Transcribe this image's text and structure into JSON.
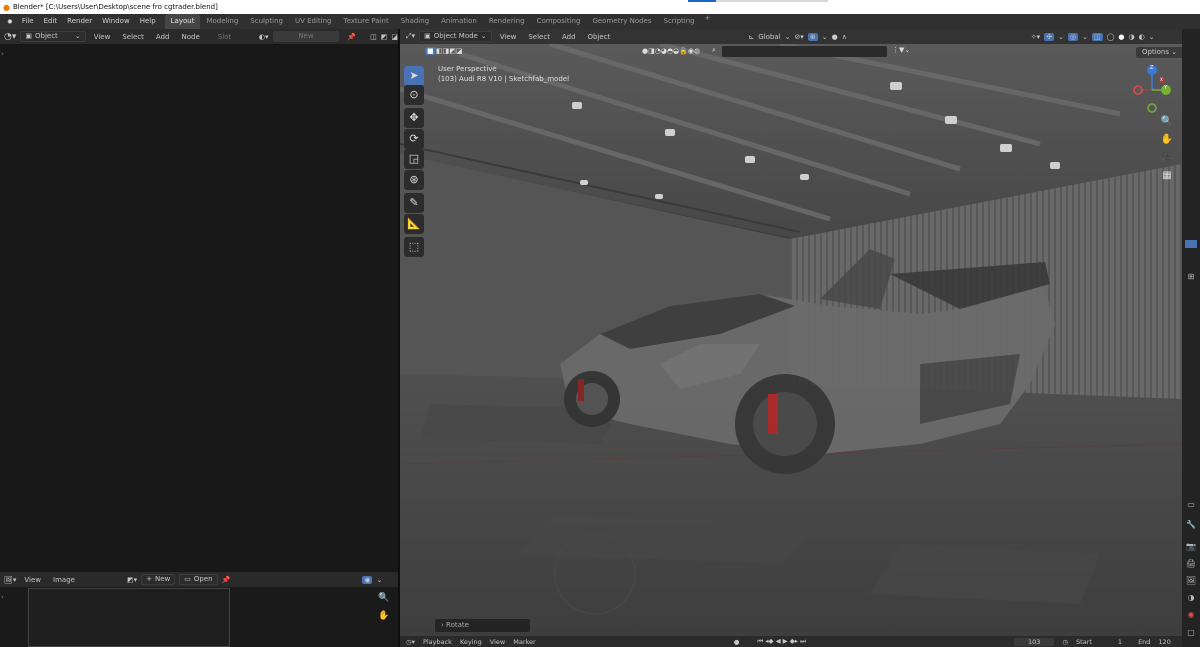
{
  "window": {
    "title": "Blender* [C:\\Users\\User\\Desktop\\scene fro cgtrader.blend]"
  },
  "menu": [
    "File",
    "Edit",
    "Render",
    "Window",
    "Help"
  ],
  "workspaces": [
    "Layout",
    "Modeling",
    "Sculpting",
    "UV Editing",
    "Texture Paint",
    "Shading",
    "Animation",
    "Rendering",
    "Compositing",
    "Geometry Nodes",
    "Scripting"
  ],
  "workspace_plus": "+",
  "node_editor_header": {
    "mode": "Object",
    "view": "View",
    "select": "Select",
    "add": "Add",
    "node": "Node",
    "slot": "Slot",
    "new": "New"
  },
  "image_editor_header": {
    "view": "View",
    "image": "Image",
    "new": "New",
    "open": "Open"
  },
  "viewport_header": {
    "mode": "Object Mode",
    "view": "View",
    "select": "Select",
    "add": "Add",
    "object": "Object",
    "orientation": "Global",
    "options": "Options"
  },
  "viewport_overlay": {
    "perspective": "User Perspective",
    "object_info": "(103) Audi R8 V10 | Sketchfab_model"
  },
  "gizmo_labels": {
    "z": "Z",
    "y": "Y",
    "x": "X"
  },
  "last_operator": "Rotate",
  "timeline": {
    "playback": "Playback",
    "keying": "Keying",
    "view": "View",
    "marker": "Marker",
    "frame": "103",
    "start_label": "Start",
    "start": "1",
    "end_label": "End",
    "end": "120"
  },
  "colors": {
    "accent": "#4772b3",
    "x_axis": "#e04a4a",
    "y_axis": "#74b236",
    "z_axis": "#3a7ad8"
  }
}
